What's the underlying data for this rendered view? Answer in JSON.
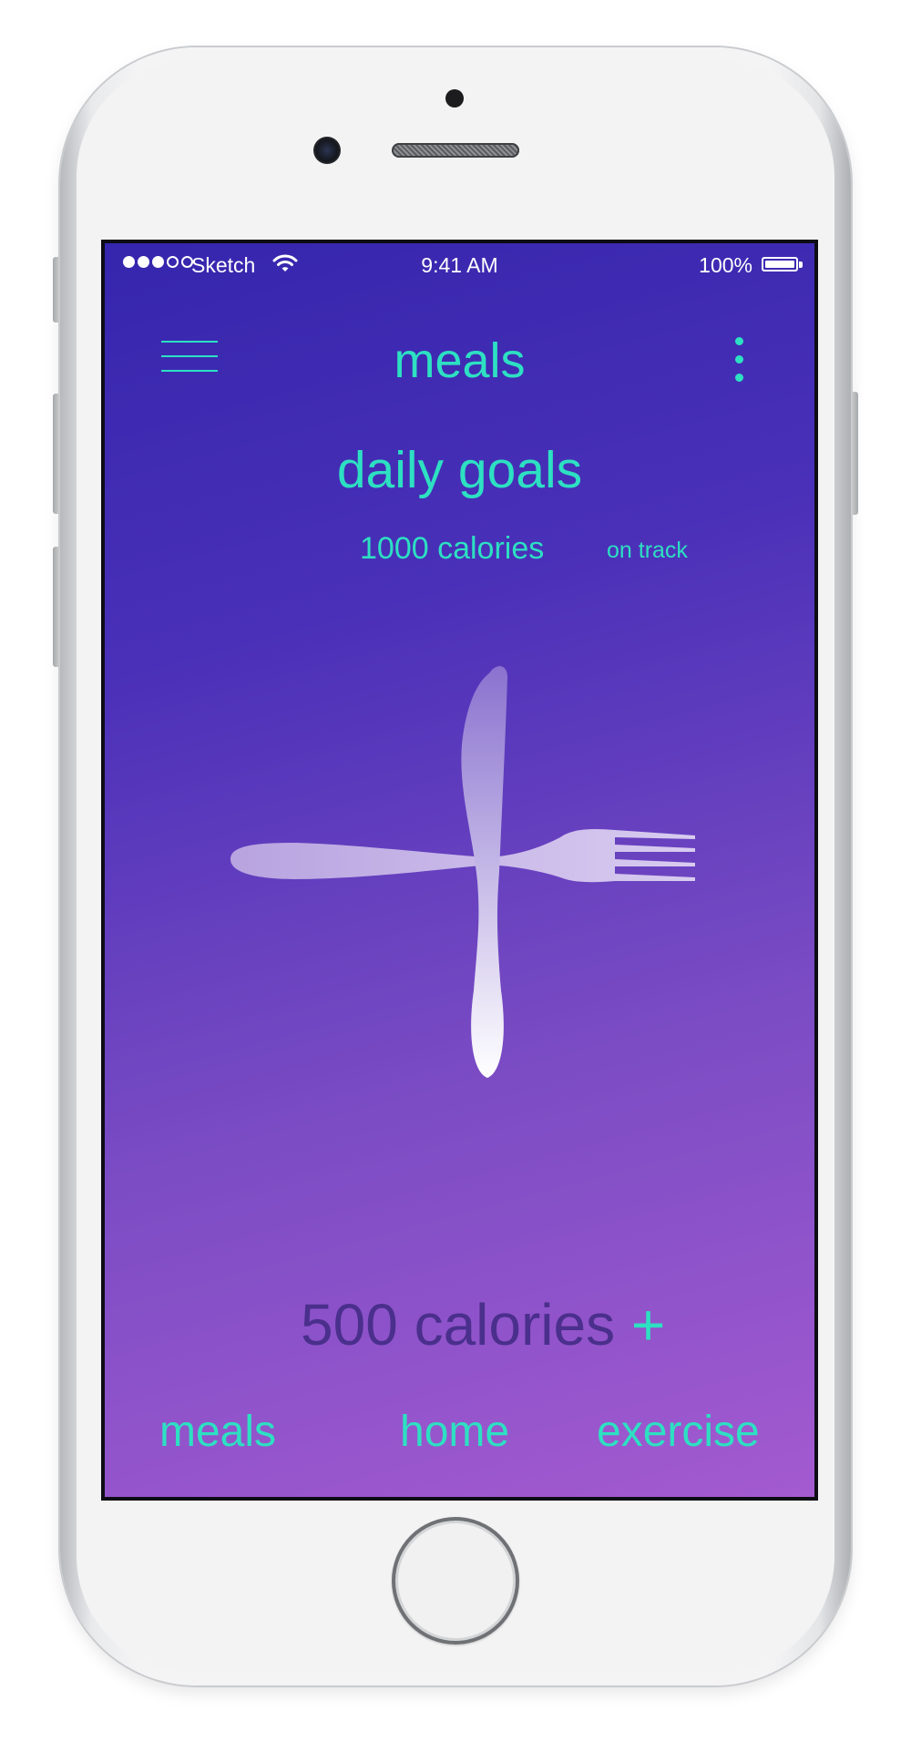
{
  "status_bar": {
    "carrier": "Sketch",
    "time": "9:41 AM",
    "battery": "100%"
  },
  "header": {
    "title": "meals",
    "menu_icon": "hamburger-menu-icon",
    "more_icon": "vertical-ellipsis-icon"
  },
  "goals": {
    "heading": "daily goals",
    "calories": "1000 calories",
    "status": "on track"
  },
  "illustration": "fork-and-knife-icon",
  "consumed": {
    "value": "500 calories",
    "add_label": "+"
  },
  "tabs": [
    {
      "label": "meals"
    },
    {
      "label": "home"
    },
    {
      "label": "exercise"
    }
  ],
  "colors": {
    "accent": "#2de0c2",
    "gradient_top": "#3526ad",
    "gradient_bottom": "#a45ad0",
    "muted_text": "#4a2f8c"
  }
}
